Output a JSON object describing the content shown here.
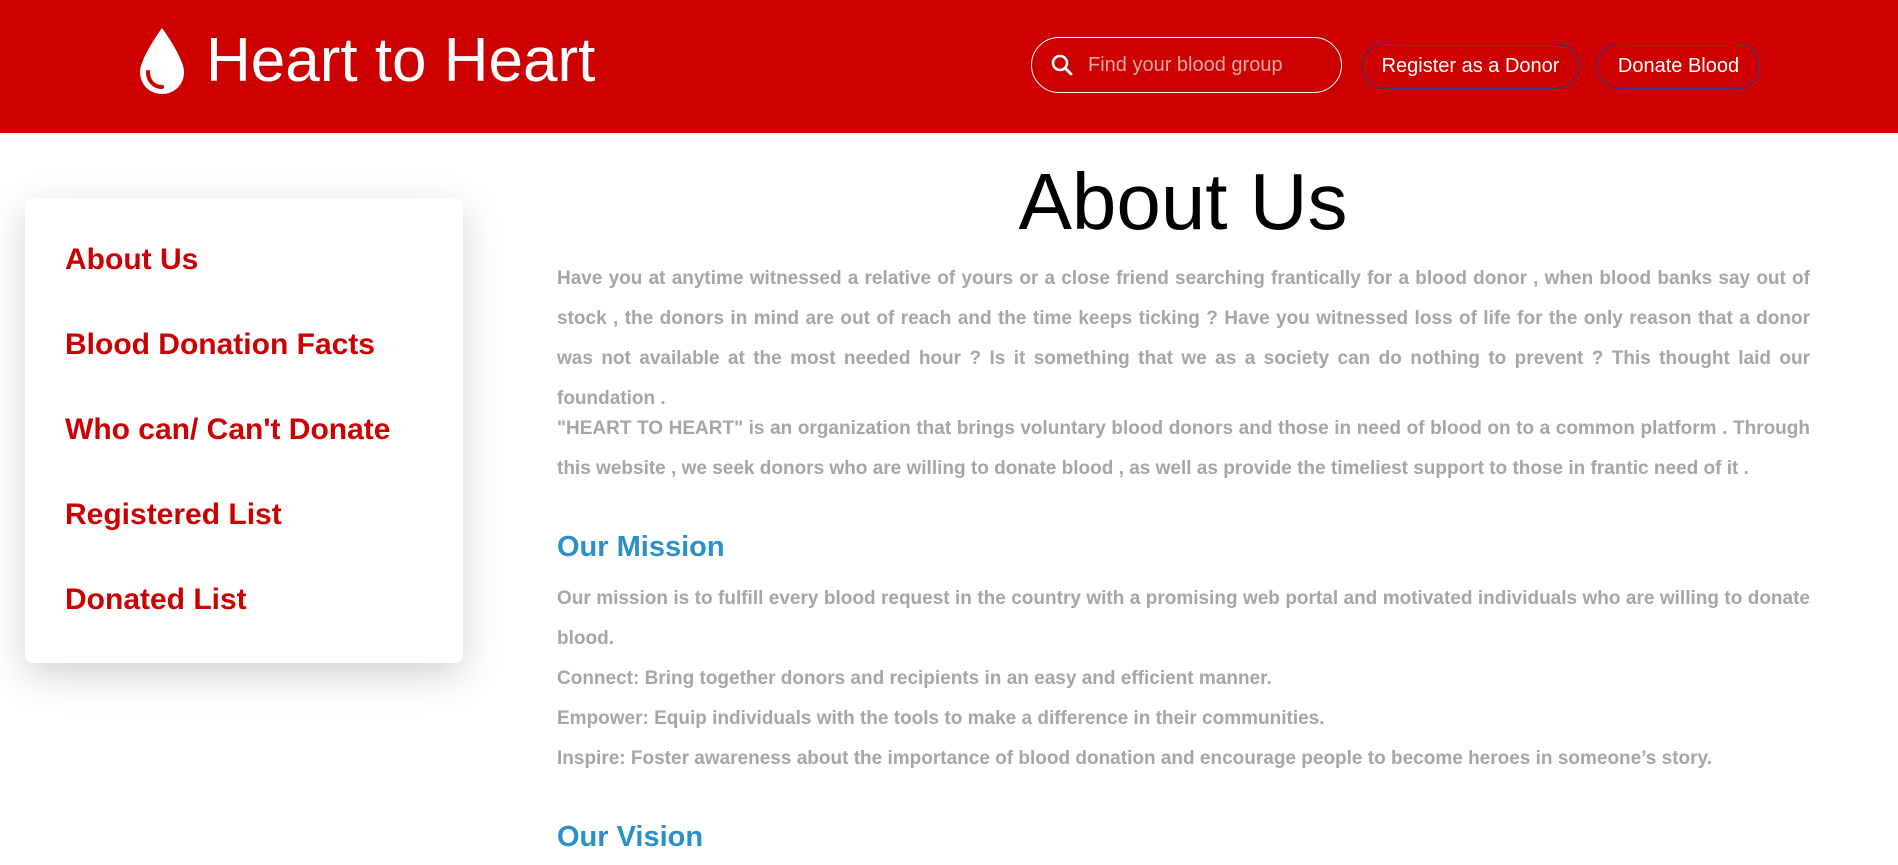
{
  "header": {
    "brand_title": "Heart to Heart",
    "brand_icon": "blood-drop-icon",
    "search": {
      "placeholder": "Find your blood group",
      "icon": "search-icon"
    },
    "register_label": "Register as a Donor",
    "donate_label": "Donate Blood"
  },
  "sidebar": {
    "items": [
      {
        "label": "About Us"
      },
      {
        "label": "Blood Donation Facts"
      },
      {
        "label": "Who can/ Can't Donate"
      },
      {
        "label": "Registered List"
      },
      {
        "label": "Donated List"
      }
    ]
  },
  "main": {
    "title": "About Us",
    "intro_paragraph": "Have you at anytime witnessed a relative of yours or a close friend searching frantically for a blood donor , when blood banks say out of stock , the donors in mind are out of reach and the time keeps ticking ? Have you witnessed loss of life for the only reason that a donor was not available at the most needed hour ? Is it something that we as a society can do nothing to prevent ? This thought laid our foundation .",
    "org_paragraph": "\"HEART TO HEART\" is an organization that brings voluntary blood donors and those in need of blood on to a common platform . Through this website , we seek donors who are willing to donate blood , as well as provide the timeliest support to those in frantic need of it .",
    "mission": {
      "heading": "Our Mission",
      "paragraph": "Our mission is to fulfill every blood request in the country with a promising web portal and motivated individuals who are willing to donate blood.",
      "connect": "Connect: Bring together donors and recipients in an easy and efficient manner.",
      "empower": "Empower: Equip individuals with the tools to make a difference in their communities.",
      "inspire": "Inspire: Foster awareness about the importance of blood donation and encourage people to become heroes in someone’s story."
    },
    "vision": {
      "heading": "Our Vision"
    }
  },
  "colors": {
    "brand_red": "#cc0000",
    "heading_blue": "#2b8fc9",
    "body_gray": "#a6a6a6",
    "button_border": "#3a3a8a"
  }
}
